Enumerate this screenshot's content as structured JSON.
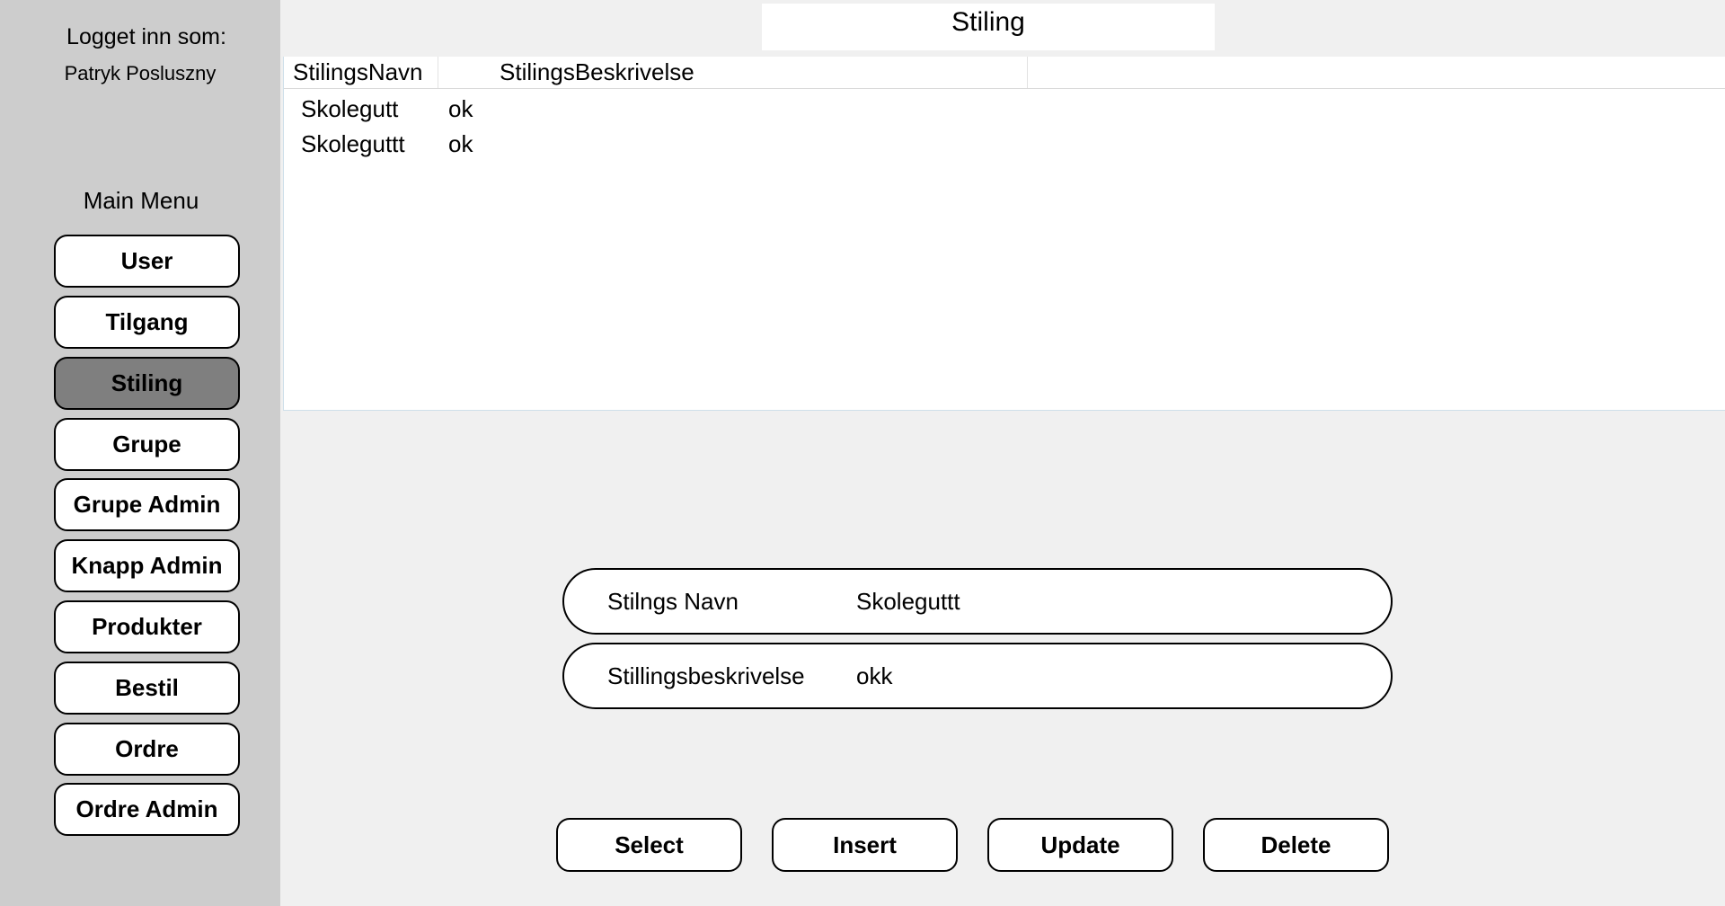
{
  "sidebar": {
    "logged_in_label": "Logget inn som:",
    "user_name": "Patryk Posluszny",
    "menu_title": "Main Menu",
    "items": [
      {
        "label": "User"
      },
      {
        "label": "Tilgang"
      },
      {
        "label": "Stiling",
        "active": true
      },
      {
        "label": "Grupe"
      },
      {
        "label": "Grupe Admin"
      },
      {
        "label": "Knapp Admin"
      },
      {
        "label": "Produkter"
      },
      {
        "label": "Bestil"
      },
      {
        "label": "Ordre"
      },
      {
        "label": "Ordre Admin"
      }
    ]
  },
  "page": {
    "title": "Stiling"
  },
  "grid": {
    "columns": [
      "StilingsNavn",
      "StilingsBeskrivelse"
    ],
    "rows": [
      [
        "Skolegutt",
        "ok"
      ],
      [
        "Skoleguttt",
        "ok"
      ]
    ]
  },
  "form": {
    "name_label": "Stilngs Navn",
    "name_value": "Skoleguttt",
    "desc_label": "Stillingsbeskrivelse",
    "desc_value": "okk"
  },
  "actions": {
    "select": "Select",
    "insert": "Insert",
    "update": "Update",
    "delete": "Delete"
  },
  "colors": {
    "sidebar_bg": "#cdcdcd",
    "content_bg": "#f0f0f0",
    "active_button": "#7f7f7f"
  }
}
